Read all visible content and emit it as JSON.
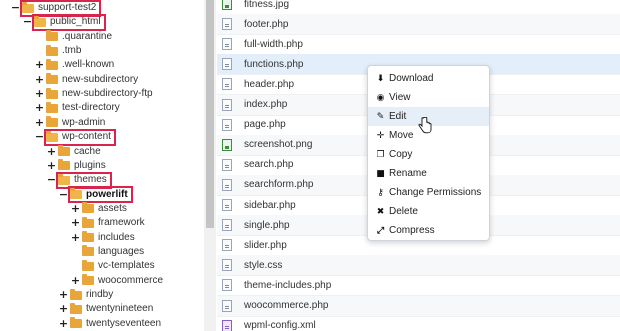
{
  "tree": [
    {
      "label": "support-test2",
      "indent": 0,
      "toggle": "−",
      "open": true,
      "highlight": true,
      "bold": false
    },
    {
      "label": "public_html",
      "indent": 1,
      "toggle": "−",
      "open": true,
      "highlight": true,
      "bold": false
    },
    {
      "label": ".quarantine",
      "indent": 2,
      "toggle": "",
      "open": false,
      "highlight": false,
      "bold": false
    },
    {
      "label": ".tmb",
      "indent": 2,
      "toggle": "",
      "open": false,
      "highlight": false,
      "bold": false
    },
    {
      "label": ".well-known",
      "indent": 2,
      "toggle": "+",
      "open": false,
      "highlight": false,
      "bold": false
    },
    {
      "label": "new-subdirectory",
      "indent": 2,
      "toggle": "+",
      "open": false,
      "highlight": false,
      "bold": false
    },
    {
      "label": "new-subdirectory-ftp",
      "indent": 2,
      "toggle": "+",
      "open": false,
      "highlight": false,
      "bold": false
    },
    {
      "label": "test-directory",
      "indent": 2,
      "toggle": "+",
      "open": false,
      "highlight": false,
      "bold": false
    },
    {
      "label": "wp-admin",
      "indent": 2,
      "toggle": "+",
      "open": false,
      "highlight": false,
      "bold": false
    },
    {
      "label": "wp-content",
      "indent": 2,
      "toggle": "−",
      "open": true,
      "highlight": true,
      "bold": false
    },
    {
      "label": "cache",
      "indent": 3,
      "toggle": "+",
      "open": false,
      "highlight": false,
      "bold": false
    },
    {
      "label": "plugins",
      "indent": 3,
      "toggle": "+",
      "open": false,
      "highlight": false,
      "bold": false
    },
    {
      "label": "themes",
      "indent": 3,
      "toggle": "−",
      "open": true,
      "highlight": true,
      "bold": false
    },
    {
      "label": "powerlift",
      "indent": 4,
      "toggle": "−",
      "open": true,
      "highlight": true,
      "bold": true
    },
    {
      "label": "assets",
      "indent": 5,
      "toggle": "+",
      "open": false,
      "highlight": false,
      "bold": false
    },
    {
      "label": "framework",
      "indent": 5,
      "toggle": "+",
      "open": false,
      "highlight": false,
      "bold": false
    },
    {
      "label": "includes",
      "indent": 5,
      "toggle": "+",
      "open": false,
      "highlight": false,
      "bold": false
    },
    {
      "label": "languages",
      "indent": 5,
      "toggle": "",
      "open": false,
      "highlight": false,
      "bold": false
    },
    {
      "label": "vc-templates",
      "indent": 5,
      "toggle": "",
      "open": false,
      "highlight": false,
      "bold": false
    },
    {
      "label": "woocommerce",
      "indent": 5,
      "toggle": "+",
      "open": false,
      "highlight": false,
      "bold": false
    },
    {
      "label": "rindby",
      "indent": 4,
      "toggle": "+",
      "open": false,
      "highlight": false,
      "bold": false
    },
    {
      "label": "twentynineteen",
      "indent": 4,
      "toggle": "+",
      "open": false,
      "highlight": false,
      "bold": false
    },
    {
      "label": "twentyseventeen",
      "indent": 4,
      "toggle": "+",
      "open": false,
      "highlight": false,
      "bold": false
    }
  ],
  "files": [
    {
      "name": "fitness.jpg",
      "type": "img"
    },
    {
      "name": "footer.php",
      "type": "code"
    },
    {
      "name": "full-width.php",
      "type": "code"
    },
    {
      "name": "functions.php",
      "type": "code",
      "selected": true
    },
    {
      "name": "header.php",
      "type": "code"
    },
    {
      "name": "index.php",
      "type": "code"
    },
    {
      "name": "page.php",
      "type": "code"
    },
    {
      "name": "screenshot.png",
      "type": "img"
    },
    {
      "name": "search.php",
      "type": "code"
    },
    {
      "name": "searchform.php",
      "type": "code"
    },
    {
      "name": "sidebar.php",
      "type": "code"
    },
    {
      "name": "single.php",
      "type": "code"
    },
    {
      "name": "slider.php",
      "type": "code"
    },
    {
      "name": "style.css",
      "type": "code"
    },
    {
      "name": "theme-includes.php",
      "type": "code"
    },
    {
      "name": "woocommerce.php",
      "type": "code"
    },
    {
      "name": "wpml-config.xml",
      "type": "xml"
    }
  ],
  "context_menu": {
    "items": [
      {
        "label": "Download",
        "icon": "download-icon",
        "glyph": "⬇"
      },
      {
        "label": "View",
        "icon": "eye-icon",
        "glyph": "◉"
      },
      {
        "label": "Edit",
        "icon": "pencil-icon",
        "glyph": "✎",
        "active": true
      },
      {
        "label": "Move",
        "icon": "move-icon",
        "glyph": "✛"
      },
      {
        "label": "Copy",
        "icon": "copy-icon",
        "glyph": "❐"
      },
      {
        "label": "Rename",
        "icon": "file-icon",
        "glyph": "■"
      },
      {
        "label": "Change Permissions",
        "icon": "key-icon",
        "glyph": "⚷"
      },
      {
        "label": "Delete",
        "icon": "delete-icon",
        "glyph": "✖"
      },
      {
        "label": "Compress",
        "icon": "compress-icon",
        "glyph": "⤢"
      }
    ]
  },
  "colors": {
    "highlight_box": "#d9254e",
    "folder": "#e8a53a",
    "selected_row": "#e3eefb"
  }
}
